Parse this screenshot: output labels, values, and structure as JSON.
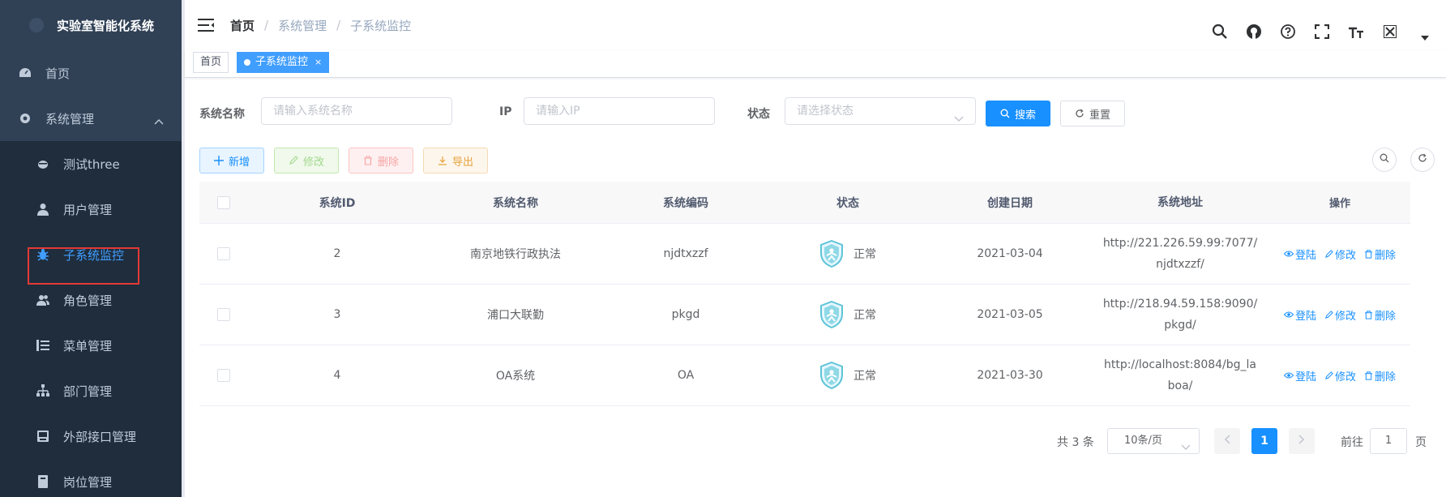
{
  "app": {
    "title": "实验室智能化系统"
  },
  "sidebar": {
    "items": [
      {
        "label": "首页",
        "icon": "dashboard-icon"
      },
      {
        "label": "系统管理",
        "icon": "gear-icon"
      },
      {
        "label": "测试three",
        "icon": "bug-icon"
      },
      {
        "label": "用户管理",
        "icon": "user-icon"
      },
      {
        "label": "子系统监控",
        "icon": "bug-icon",
        "active": true
      },
      {
        "label": "角色管理",
        "icon": "peoples-icon"
      },
      {
        "label": "菜单管理",
        "icon": "tree-table-icon"
      },
      {
        "label": "部门管理",
        "icon": "tree-icon"
      },
      {
        "label": "外部接口管理",
        "icon": "monitor-icon"
      },
      {
        "label": "岗位管理",
        "icon": "post-icon"
      }
    ]
  },
  "navbar": {
    "breadcrumb": [
      "首页",
      "系统管理",
      "子系统监控"
    ],
    "separator": "/"
  },
  "tags": [
    {
      "label": "首页"
    },
    {
      "label": "子系统监控",
      "active": true,
      "close": "×"
    }
  ],
  "search": {
    "name_label": "系统名称",
    "name_placeholder": "请输入系统名称",
    "ip_label": "IP",
    "ip_placeholder": "请输入IP",
    "status_label": "状态",
    "status_placeholder": "请选择状态",
    "search_btn": "搜索",
    "reset_btn": "重置"
  },
  "toolbar": {
    "add": "新增",
    "edit": "修改",
    "delete": "删除",
    "export": "导出"
  },
  "table": {
    "columns": [
      "系统ID",
      "系统名称",
      "系统编码",
      "状态",
      "创建日期",
      "系统地址",
      "操作"
    ],
    "rows": [
      {
        "id": "2",
        "name": "南京地铁行政执法",
        "code": "njdtxzzf",
        "status": "正常",
        "date": "2021-03-04",
        "url1": "http://221.226.59.99:7077/",
        "url2": "njdtxzzf/"
      },
      {
        "id": "3",
        "name": "浦口大联勤",
        "code": "pkgd",
        "status": "正常",
        "date": "2021-03-05",
        "url1": "http://218.94.59.158:9090/",
        "url2": "pkgd/"
      },
      {
        "id": "4",
        "name": "OA系统",
        "code": "OA",
        "status": "正常",
        "date": "2021-03-30",
        "url1": "http://localhost:8084/bg_la",
        "url2": "boa/"
      }
    ],
    "ops": {
      "login": "登陆",
      "edit": "修改",
      "delete": "删除"
    }
  },
  "pagination": {
    "total": "共 3 条",
    "page_size": "10条/页",
    "current": "1",
    "goto_label": "前往",
    "goto_value": "1",
    "goto_unit": "页"
  },
  "colors": {
    "sidebar_bg": "#304156",
    "primary": "#1890ff",
    "highlight_border": "#e53935"
  }
}
